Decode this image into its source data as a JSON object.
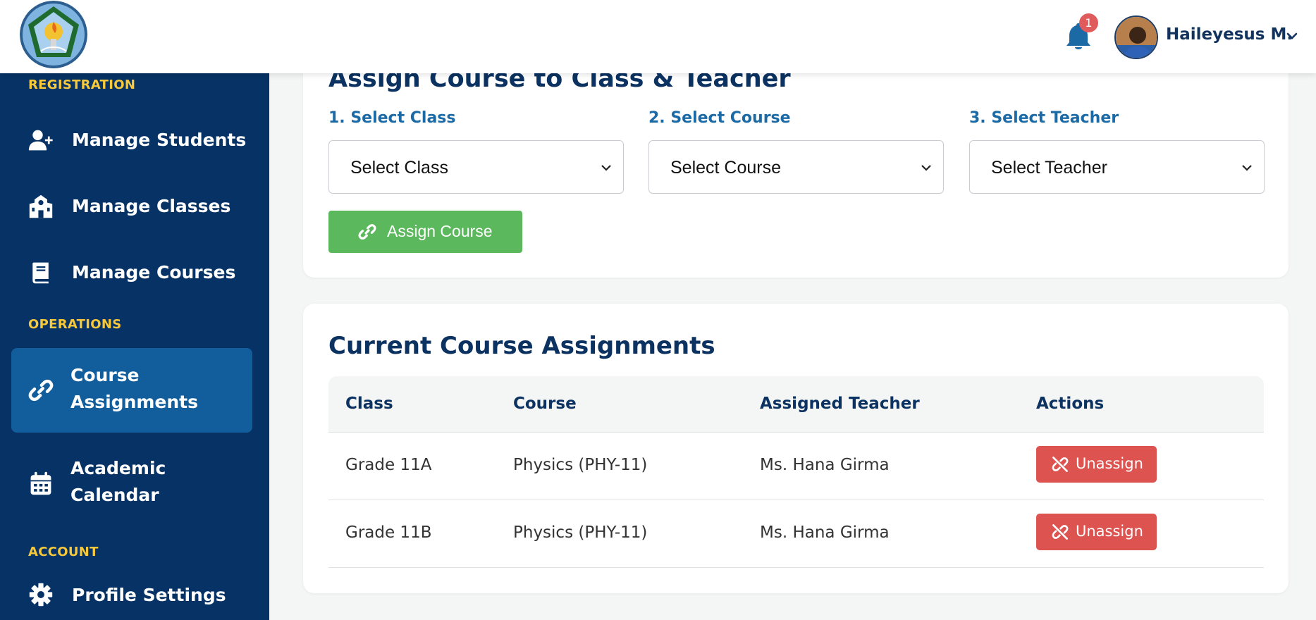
{
  "header": {
    "notification_count": "1",
    "user_name": "Haileyesus M."
  },
  "sidebar": {
    "sections": [
      {
        "label": "REGISTRATION"
      },
      {
        "label": "OPERATIONS"
      },
      {
        "label": "ACCOUNT"
      }
    ],
    "items": [
      {
        "label": "Manage Students",
        "icon": "user-plus-icon"
      },
      {
        "label": "Manage Classes",
        "icon": "school-icon"
      },
      {
        "label": "Manage Courses",
        "icon": "book-icon"
      },
      {
        "label_line1": "Course",
        "label_line2": "Assignments",
        "icon": "link-icon",
        "active": true
      },
      {
        "label_line1": "Academic",
        "label_line2": "Calendar",
        "icon": "calendar-icon"
      },
      {
        "label": "Profile Settings",
        "icon": "gear-icon"
      }
    ]
  },
  "assign_card": {
    "title": "Assign Course to Class & Teacher",
    "fields": [
      {
        "label": "1. Select Class",
        "value": "Select Class"
      },
      {
        "label": "2. Select Course",
        "value": "Select Course"
      },
      {
        "label": "3. Select Teacher",
        "value": "Select Teacher"
      }
    ],
    "button_label": "Assign Course"
  },
  "assignments_card": {
    "title": "Current Course Assignments",
    "columns": [
      "Class",
      "Course",
      "Assigned Teacher",
      "Actions"
    ],
    "rows": [
      {
        "class": "Grade 11A",
        "course": "Physics (PHY-11)",
        "teacher": "Ms. Hana Girma",
        "action": "Unassign"
      },
      {
        "class": "Grade 11B",
        "course": "Physics (PHY-11)",
        "teacher": "Ms. Hana Girma",
        "action": "Unassign"
      }
    ]
  },
  "colors": {
    "sidebar_bg": "#063265",
    "sidebar_active": "#125e9c",
    "section_label": "#f6c83a",
    "primary_text": "#0b3261",
    "success": "#5cb85c",
    "danger": "#dc5350",
    "badge": "#e05b5b"
  }
}
